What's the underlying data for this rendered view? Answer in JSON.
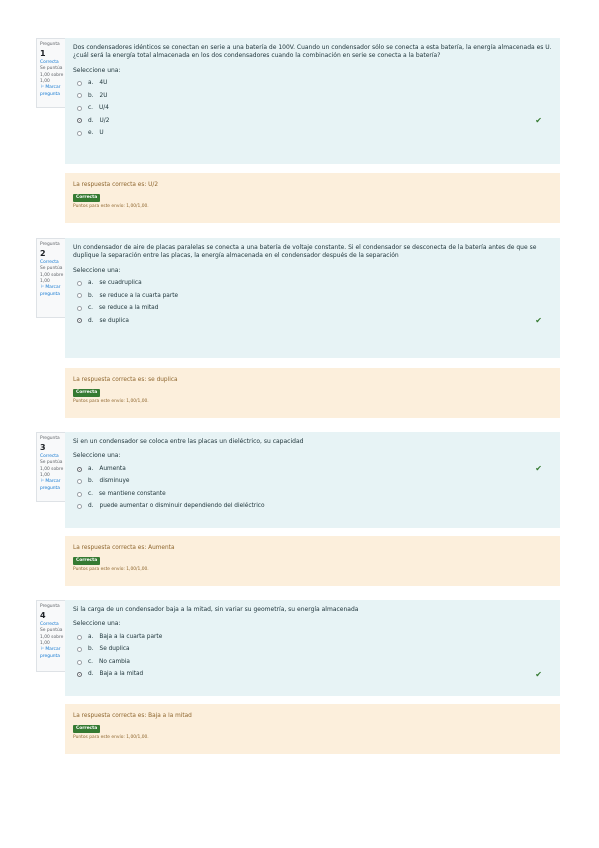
{
  "questions": [
    {
      "label": "Pregunta",
      "number": "1",
      "state": "Correcta",
      "score": "Se puntúa 1,00 sobre 1,00",
      "flag": "Marcar pregunta",
      "text": "Dos condensadores idénticos se conectan en serie a una batería de 100V. Cuando un condensador sólo se conecta a esta batería, la energía almacenada es U. ¿cuál será la energía total almacenada en los dos condensadores cuando la combinación en serie se conecta a la batería?",
      "prompt": "Seleccione una:",
      "options": [
        {
          "letter": "a.",
          "text": "4U"
        },
        {
          "letter": "b.",
          "text": "2U"
        },
        {
          "letter": "c.",
          "text": "U/4"
        },
        {
          "letter": "d.",
          "text": "U/2"
        },
        {
          "letter": "e.",
          "text": "U"
        }
      ],
      "selected_index": 3,
      "feedback": "La respuesta correcta es: U/2",
      "result": "Correcta",
      "points": "Puntos para este envío: 1,00/1,00."
    },
    {
      "label": "Pregunta",
      "number": "2",
      "state": "Correcta",
      "score": "Se puntúa 1,00 sobre 1,00",
      "flag": "Marcar pregunta",
      "text": "Un condensador de aire de placas paralelas se conecta a una batería de voltaje constante. Si el condensador se desconecta de la batería antes de que se duplique la separación entre las placas, la energía almacenada en el condensador después de la separación",
      "prompt": "Seleccione una:",
      "options": [
        {
          "letter": "a.",
          "text": "se cuadruplica"
        },
        {
          "letter": "b.",
          "text": "se reduce a la cuarta parte"
        },
        {
          "letter": "c.",
          "text": "se reduce a la mitad"
        },
        {
          "letter": "d.",
          "text": "se duplica"
        }
      ],
      "selected_index": 3,
      "feedback": "La respuesta correcta es: se duplica",
      "result": "Correcta",
      "points": "Puntos para este envío: 1,00/1,00."
    },
    {
      "label": "Pregunta",
      "number": "3",
      "state": "Correcta",
      "score": "Se puntúa 1,00 sobre 1,00",
      "flag": "Marcar pregunta",
      "text": "Si en un condensador se coloca entre las placas un dieléctrico, su capacidad",
      "prompt": "Seleccione una:",
      "options": [
        {
          "letter": "a.",
          "text": "Aumenta"
        },
        {
          "letter": "b.",
          "text": "disminuye"
        },
        {
          "letter": "c.",
          "text": "se mantiene constante"
        },
        {
          "letter": "d.",
          "text": "puede aumentar o disminuir dependiendo del dieléctrico"
        }
      ],
      "selected_index": 0,
      "feedback": "La respuesta correcta es: Aumenta",
      "result": "Correcta",
      "points": "Puntos para este envío: 1,00/1,00."
    },
    {
      "label": "Pregunta",
      "number": "4",
      "state": "Correcta",
      "score": "Se puntúa 1,00 sobre 1,00",
      "flag": "Marcar pregunta",
      "text": "Si la carga de un condensador baja a la mitad, sin variar su geometría, su energía almacenada",
      "prompt": "Seleccione una:",
      "options": [
        {
          "letter": "a.",
          "text": "Baja a la cuarta parte"
        },
        {
          "letter": "b.",
          "text": "Se duplica"
        },
        {
          "letter": "c.",
          "text": "No cambia"
        },
        {
          "letter": "d.",
          "text": "Baja a la mitad"
        }
      ],
      "selected_index": 3,
      "feedback": "La respuesta correcta es: Baja a la mitad",
      "result": "Correcta",
      "points": "Puntos para este envío: 1,00/1,00."
    }
  ],
  "icons": {
    "correct": "check-icon",
    "flag": "flag-icon"
  },
  "colors": {
    "correct": "#357a32",
    "question_bg": "#e7f3f5",
    "feedback_bg": "#fcefdc"
  }
}
